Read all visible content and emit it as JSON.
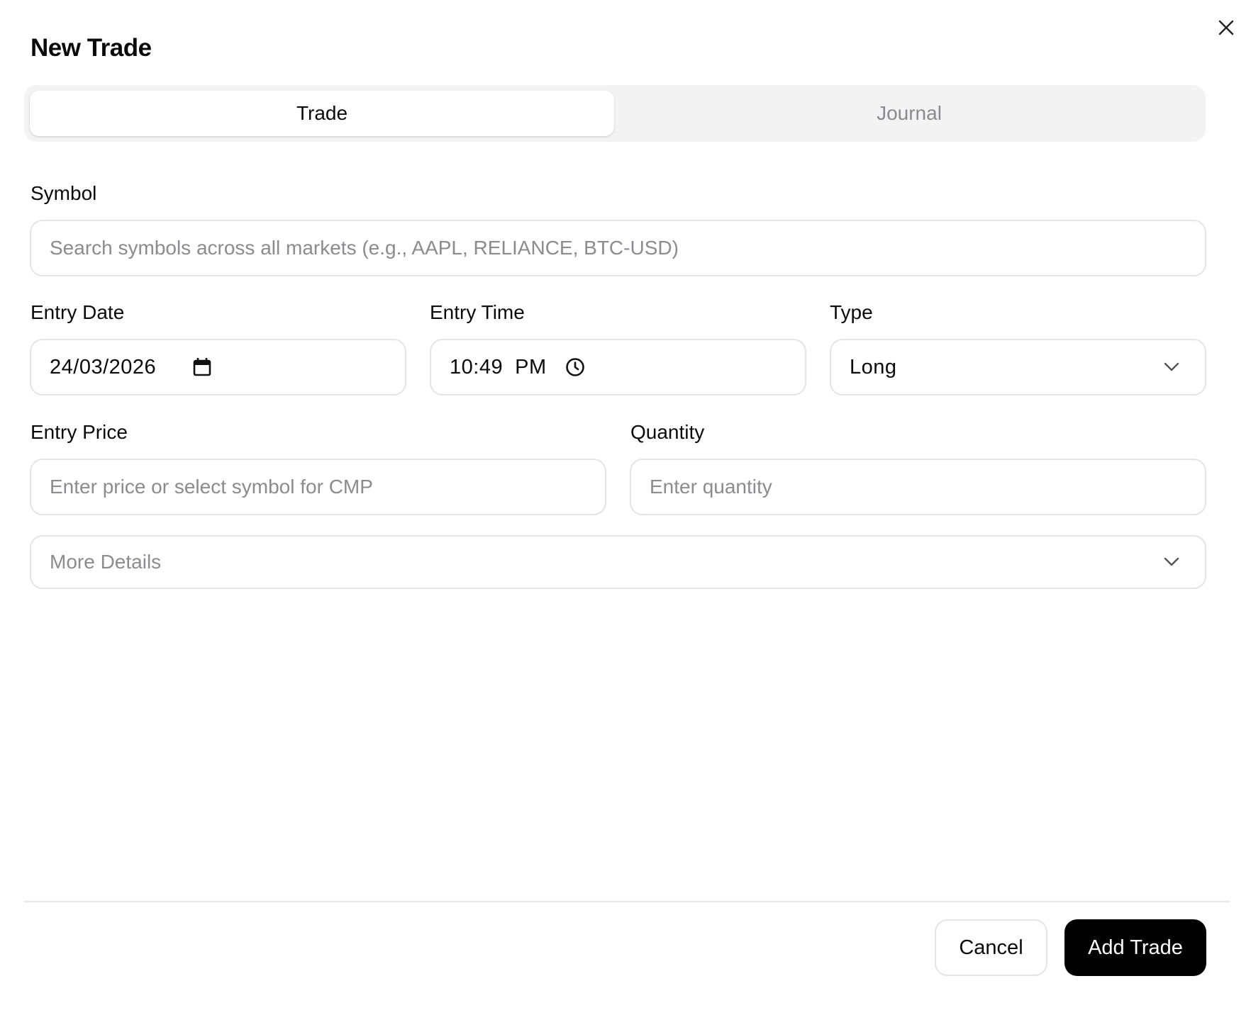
{
  "dialog": {
    "title": "New Trade",
    "close_icon": "close-icon"
  },
  "tabs": [
    {
      "label": "Trade",
      "active": true
    },
    {
      "label": "Journal",
      "active": false
    }
  ],
  "form": {
    "symbol": {
      "label": "Symbol",
      "placeholder": "Search symbols across all markets (e.g., AAPL, RELIANCE, BTC-USD)",
      "value": ""
    },
    "entry_date": {
      "label": "Entry Date",
      "value": "24/03/2026",
      "icon": "calendar-icon"
    },
    "entry_time": {
      "label": "Entry Time",
      "value": "10:49  PM",
      "icon": "clock-icon"
    },
    "type": {
      "label": "Type",
      "value": "Long",
      "icon": "chevron-down-icon"
    },
    "entry_price": {
      "label": "Entry Price",
      "placeholder": "Enter price or select symbol for CMP",
      "value": ""
    },
    "quantity": {
      "label": "Quantity",
      "placeholder": "Enter quantity",
      "value": ""
    },
    "more_details": {
      "label": "More Details",
      "icon": "chevron-down-icon"
    }
  },
  "footer": {
    "cancel_label": "Cancel",
    "submit_label": "Add Trade"
  },
  "colors": {
    "primary": "#000000",
    "border": "#e4e4e7",
    "muted_text": "#8b8b90",
    "tab_track": "#f3f3f4"
  }
}
